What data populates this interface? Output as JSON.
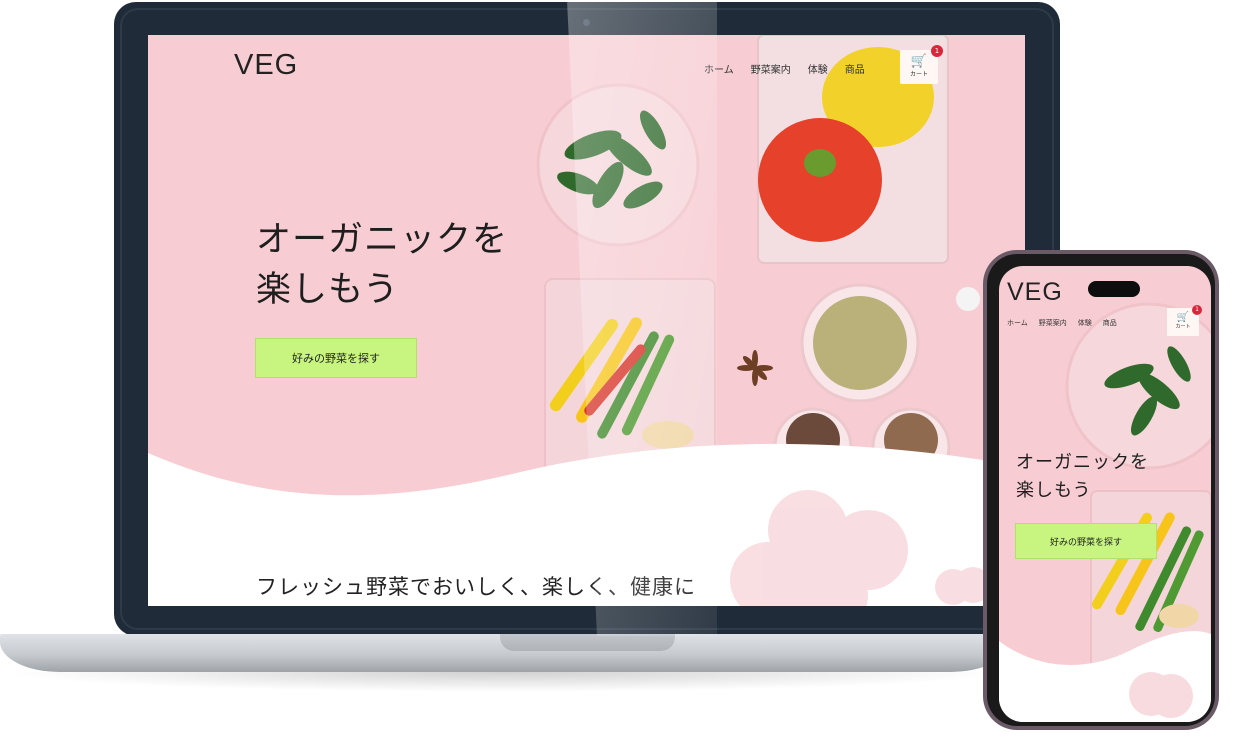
{
  "brand": {
    "logo": "VEG"
  },
  "nav": {
    "items": [
      "ホーム",
      "野菜案内",
      "体験",
      "商品"
    ]
  },
  "cart": {
    "label": "カート",
    "count": "1"
  },
  "hero": {
    "title_line1": "オーガニックを",
    "title_line2": "楽しもう",
    "cta_label": "好みの野菜を探す"
  },
  "section": {
    "heading": "フレッシュ野菜でおいしく、楽しく、健康に"
  },
  "colors": {
    "hero_bg": "#f7cdd3",
    "cta_bg": "#c7f57f",
    "badge": "#d9263b",
    "laptop_bezel": "#1f2b38"
  },
  "icons": {
    "cart": "shopping-cart-icon"
  }
}
